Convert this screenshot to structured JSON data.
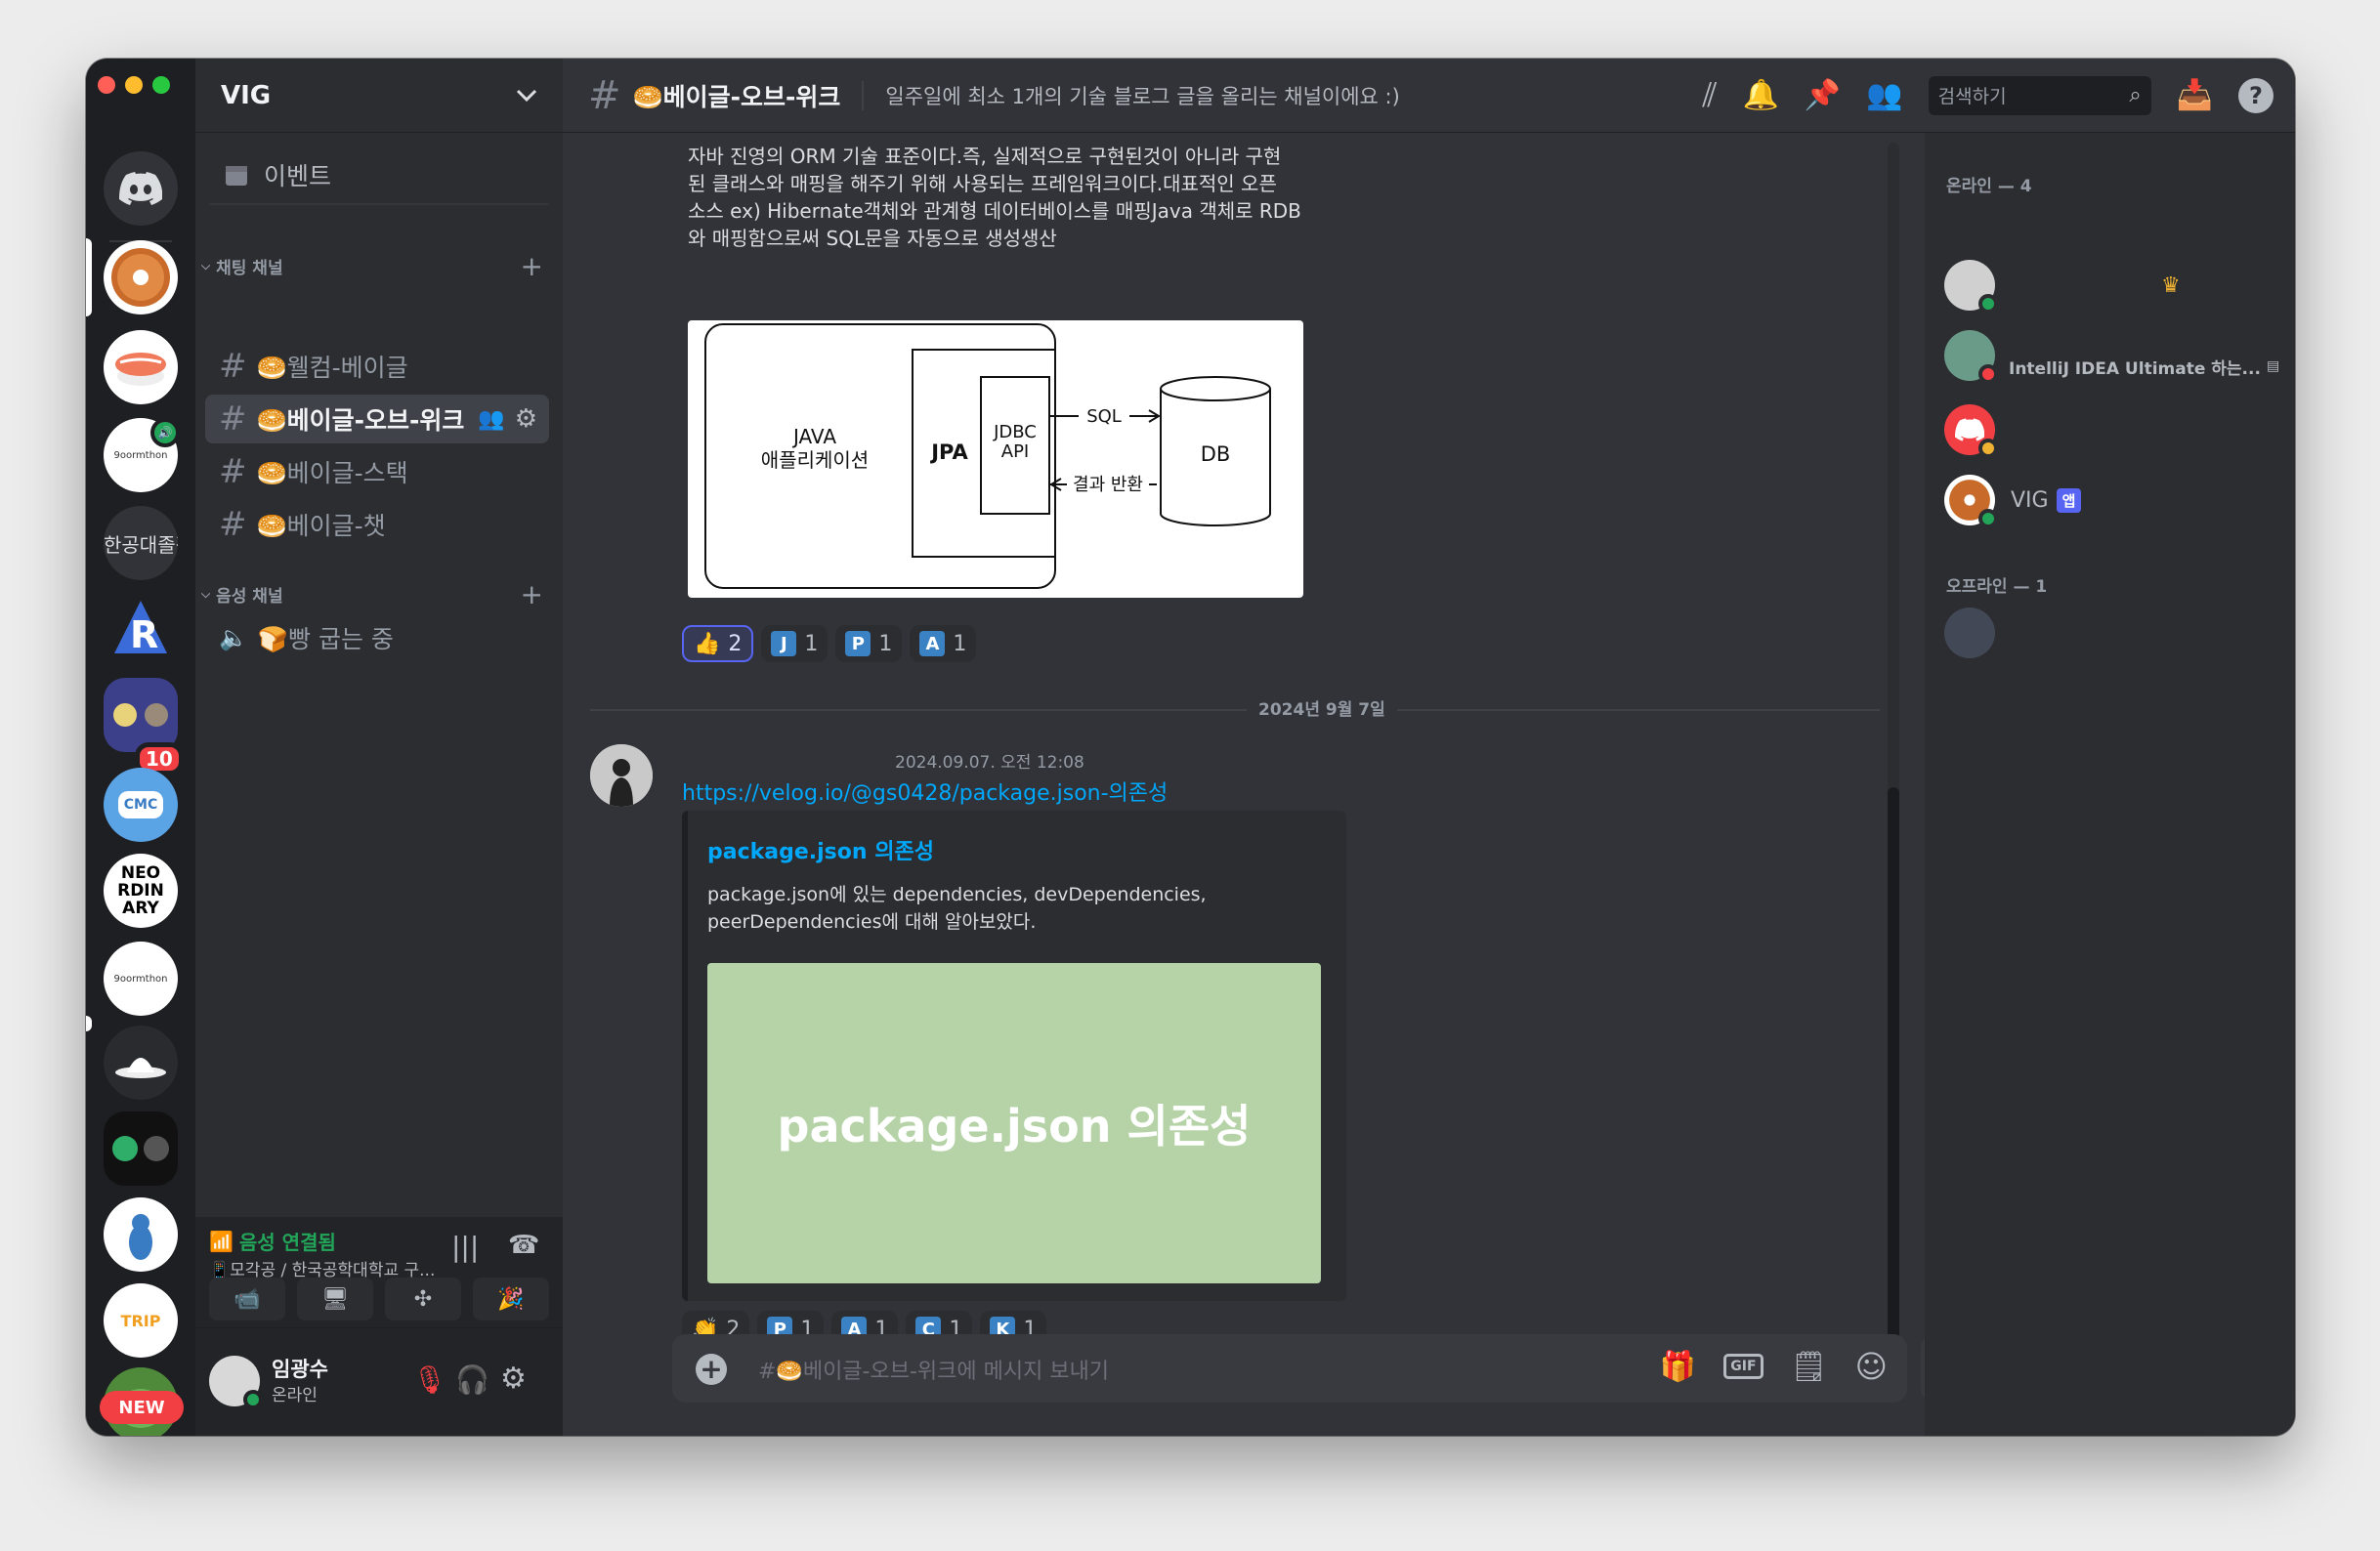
{
  "server": {
    "name": "VIG"
  },
  "rail": {
    "new_badge": "NEW",
    "unread_badge": "10",
    "cut_server_text": "한공대졸작",
    "cmc_label": "CMC",
    "ordinary_text": "NEO RDIN ARY",
    "goormthon_label": "9oormthon",
    "trip_label": "TRIP"
  },
  "sidebar": {
    "events_label": "이벤트",
    "text_category": "채팅 채널",
    "voice_category": "음성 채널",
    "channels": [
      {
        "name": "🥯웰컴-베이글",
        "active": false
      },
      {
        "name": "🥯베이글-오브-위크",
        "active": true
      },
      {
        "name": "🥯베이글-스택",
        "active": false
      },
      {
        "name": "🥯베이글-챗",
        "active": false
      }
    ],
    "voice_channels": [
      {
        "name": "🍞빵 굽는 중"
      }
    ],
    "voice_status": {
      "title": "음성 연결됨",
      "subtitle": "📱모각공 / 한국공학대학교 구..."
    },
    "user": {
      "name": "임광수",
      "status": "온라인"
    }
  },
  "header": {
    "channel_name": "🥯베이글-오브-위크",
    "topic": "일주일에 최소 1개의 기술 블로그 글을 올리는 채널이에요 :)",
    "search_placeholder": "검색하기"
  },
  "messages": {
    "top_text": [
      "자바 진영의 ORM 기술 표준이다.즉, 실제적으로 구현된것이 아니라 구현",
      "된 클래스와 매핑을 해주기 위해 사용되는 프레임워크이다.대표적인 오픈",
      "소스 ex) Hibernate객체와 관계형 데이터베이스를 매핑Java 객체로 RDB",
      "와 매핑함으로써 SQL문을 자동으로 생성생산"
    ],
    "diagram": {
      "app_label_1": "JAVA",
      "app_label_2": "애플리케이션",
      "jpa_label": "JPA",
      "jdbc_label_1": "JDBC",
      "jdbc_label_2": "API",
      "sql_label": "SQL",
      "result_label": "결과 반환",
      "db_label": "DB"
    },
    "reactions_1": [
      {
        "emoji": "👍",
        "count": "2",
        "letter": "",
        "color": "",
        "selected": true
      },
      {
        "emoji": "",
        "count": "1",
        "letter": "J",
        "color": "#3b82c4",
        "selected": false
      },
      {
        "emoji": "",
        "count": "1",
        "letter": "P",
        "color": "#3b82c4",
        "selected": false
      },
      {
        "emoji": "",
        "count": "1",
        "letter": "A",
        "color": "#3b82c4",
        "selected": false
      }
    ],
    "date_divider": "2024년 9월 7일",
    "timestamp": "2024.09.07. 오전 12:08",
    "link_text": "https://velog.io/@gs0428/package.json-의존성",
    "embed": {
      "title": "package.json 의존성",
      "desc_1": "package.json에 있는 dependencies, devDependencies,",
      "desc_2": "peerDependencies에 대해 알아보았다.",
      "image_text": "package.json 의존성",
      "image_color": "#b5d3a7"
    },
    "reactions_2": [
      {
        "emoji": "👏",
        "count": "2",
        "letter": "",
        "color": ""
      },
      {
        "emoji": "",
        "count": "1",
        "letter": "P",
        "color": "#3b82c4"
      },
      {
        "emoji": "",
        "count": "1",
        "letter": "A",
        "color": "#3b82c4"
      },
      {
        "emoji": "",
        "count": "1",
        "letter": "C",
        "color": "#3b82c4"
      },
      {
        "emoji": "",
        "count": "1",
        "letter": "K",
        "color": "#3b82c4"
      }
    ]
  },
  "composer": {
    "placeholder": "#🥯베이글-오브-위크에 메시지 보내기",
    "gif_label": "GIF"
  },
  "members": {
    "online_header": "온라인 — 4",
    "offline_header": "오프라인 — 1",
    "m2_activity": "IntelliJ IDEA Ultimate 하는...",
    "vig_name": "VIG",
    "vig_tag": "앱"
  },
  "colors": {
    "accent": "#5865f2",
    "online": "#23a559",
    "dnd": "#f23f43",
    "idle": "#f0b232",
    "link": "#00a8fc"
  }
}
